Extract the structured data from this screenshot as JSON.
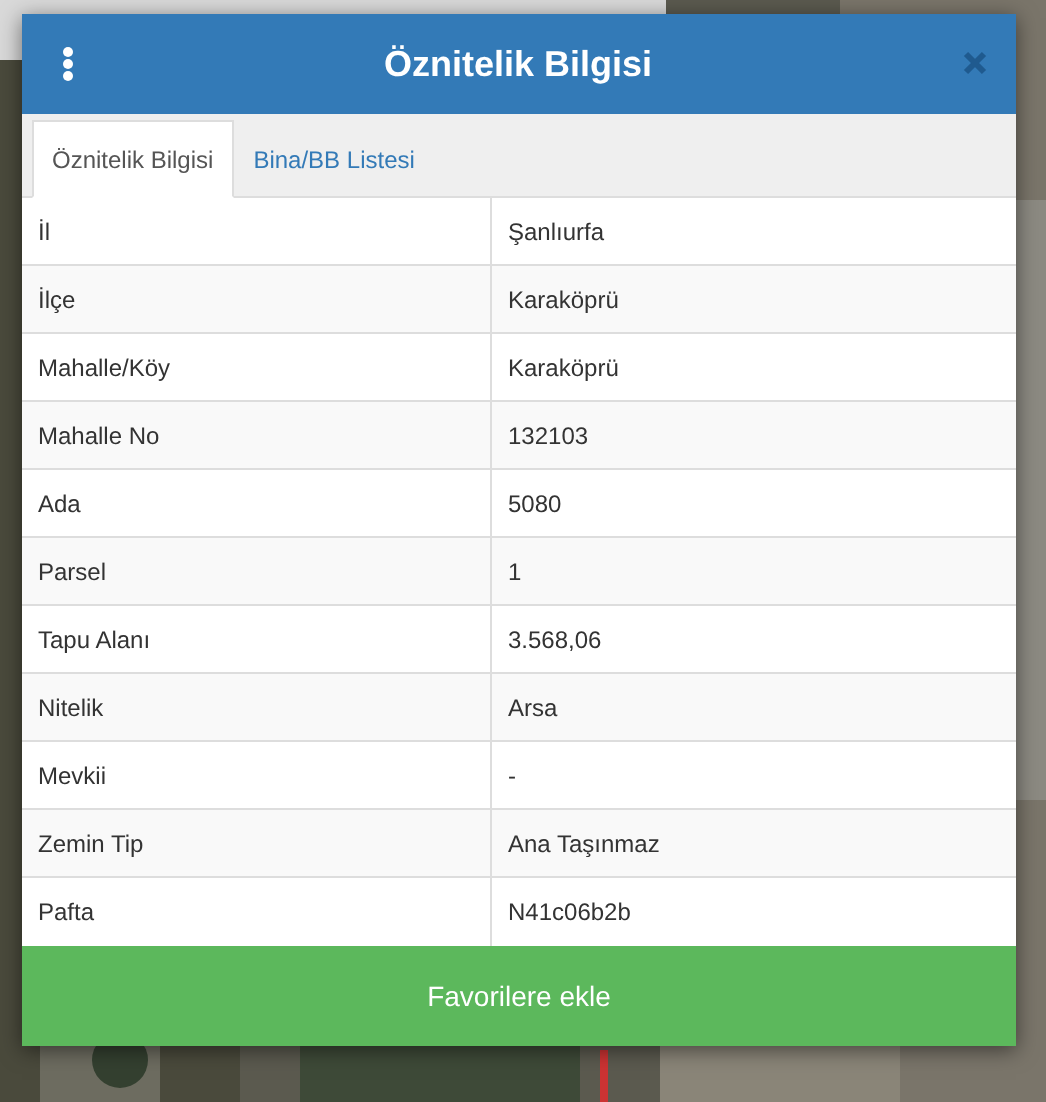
{
  "dialog": {
    "title": "Öznitelik Bilgisi"
  },
  "tabs": [
    {
      "label": "Öznitelik Bilgisi",
      "selected": true
    },
    {
      "label": "Bina/BB Listesi",
      "selected": false
    }
  ],
  "table": {
    "rows": [
      {
        "label": "İl",
        "value": "Şanlıurfa"
      },
      {
        "label": "İlçe",
        "value": "Karaköprü"
      },
      {
        "label": "Mahalle/Köy",
        "value": "Karaköprü"
      },
      {
        "label": "Mahalle No",
        "value": "132103"
      },
      {
        "label": "Ada",
        "value": "5080"
      },
      {
        "label": "Parsel",
        "value": "1"
      },
      {
        "label": "Tapu Alanı",
        "value": "3.568,06"
      },
      {
        "label": "Nitelik",
        "value": "Arsa"
      },
      {
        "label": "Mevkii",
        "value": "-"
      },
      {
        "label": "Zemin Tip",
        "value": "Ana Taşınmaz"
      },
      {
        "label": "Pafta",
        "value": "N41c06b2b"
      }
    ]
  },
  "footer_button": "Favorilere ekle"
}
